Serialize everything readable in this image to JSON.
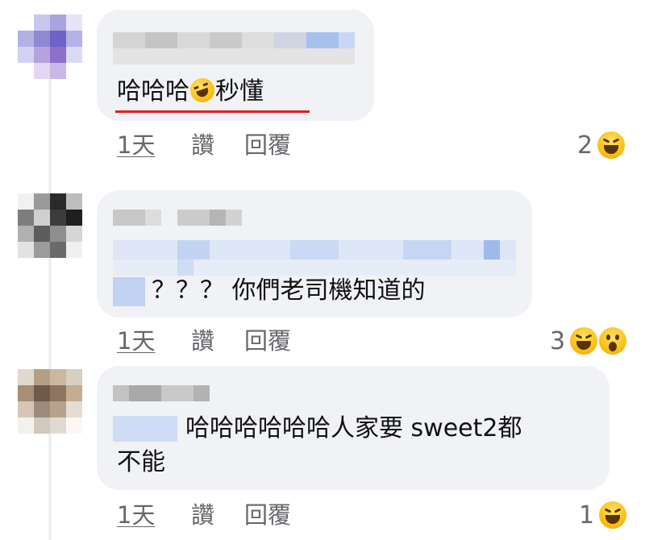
{
  "comments": [
    {
      "text": "哈哈哈",
      "text_after_emoji": "秒懂",
      "emoji": "rolling-on-floor-laughing",
      "time": "1天",
      "like_label": "讚",
      "reply_label": "回覆",
      "reaction_count": "2",
      "reactions": [
        "haha"
      ]
    },
    {
      "text": "？？？ 你們老司機知道的",
      "time": "1天",
      "like_label": "讚",
      "reply_label": "回覆",
      "reaction_count": "3",
      "reactions": [
        "haha",
        "wow"
      ]
    },
    {
      "text_line1": "哈哈哈哈哈哈人家要 sweet2都",
      "text_line2": "不能",
      "time": "1天",
      "like_label": "讚",
      "reply_label": "回覆",
      "reaction_count": "1",
      "reactions": [
        "haha"
      ]
    }
  ],
  "colors": {
    "bubble": "#f0f2f5",
    "meta_text": "#65676b",
    "underline_highlight": "#e02020",
    "blur_blue": "#c9d8f3",
    "blur_gray": "#d2d2d2"
  }
}
